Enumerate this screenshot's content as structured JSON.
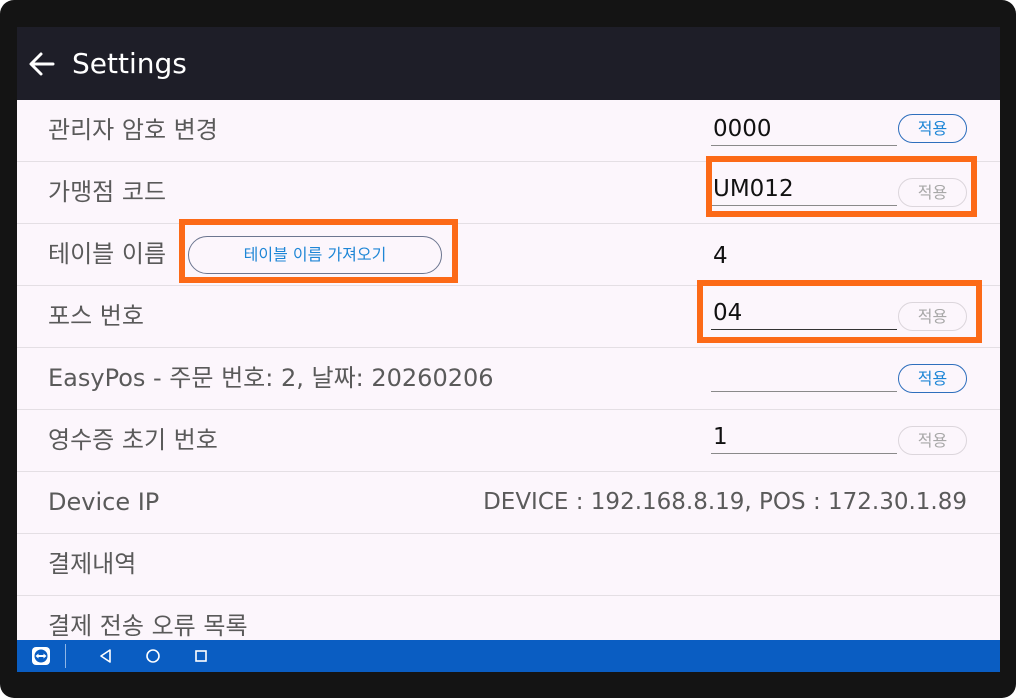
{
  "appbar": {
    "title": "Settings",
    "back_icon": "arrow-left-icon"
  },
  "rows": {
    "admin_password": {
      "label": "관리자 암호 변경",
      "value": "0000",
      "apply_label": "적용",
      "apply_enabled": true
    },
    "store_code": {
      "label": "가맹점 코드",
      "value": "UM012",
      "apply_label": "적용",
      "apply_enabled": false
    },
    "table_name": {
      "label": "테이블 이름",
      "fetch_label": "테이블 이름 가져오기",
      "value": "4"
    },
    "pos_number": {
      "label": "포스 번호",
      "value": "04",
      "apply_label": "적용",
      "apply_enabled": false
    },
    "easypos": {
      "label": "EasyPos - 주문 번호: 2, 날짜: 20260206",
      "value": "",
      "apply_label": "적용",
      "apply_enabled": true
    },
    "receipt_start": {
      "label": "영수증 초기 번호",
      "value": "1",
      "apply_label": "적용",
      "apply_enabled": false
    },
    "device_ip": {
      "label": "Device IP",
      "value": "DEVICE : 192.168.8.19, POS : 172.30.1.89"
    },
    "payment_history": {
      "label": "결제내역"
    },
    "payment_errors": {
      "label": "결제 전송 오류 목록"
    }
  },
  "colors": {
    "highlight": "#fc6a17",
    "appbar": "#1e1e28",
    "navbar": "#0a5dc2",
    "accent": "#1e86d6"
  },
  "navbar": {
    "icons": [
      "teamviewer-icon",
      "back-triangle-icon",
      "home-circle-icon",
      "recents-square-icon"
    ]
  }
}
